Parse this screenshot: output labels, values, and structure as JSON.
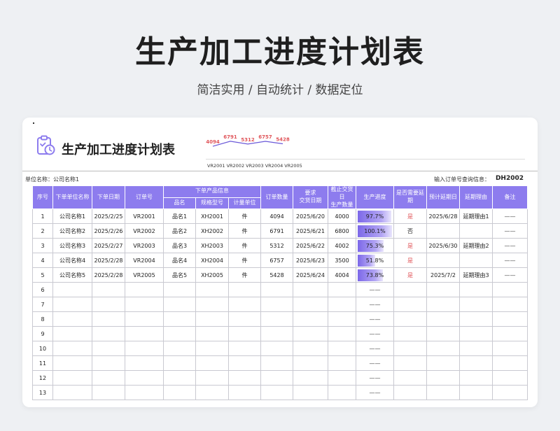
{
  "page": {
    "title": "生产加工进度计划表",
    "subtitle": "简洁实用 / 自动统计 / 数据定位"
  },
  "sheet": {
    "title": "生产加工进度计划表",
    "icon": "clipboard-clock-icon",
    "accent_color": "#8d7cee",
    "warning_color": "#e0555a"
  },
  "sparkline": {
    "categories": [
      "VR2001",
      "VR2002",
      "VR2003",
      "VR2004",
      "VR2005"
    ],
    "values": [
      4094,
      6791,
      5312,
      6757,
      5428
    ],
    "labels": [
      "4094",
      "6791",
      "5312",
      "6757",
      "5428"
    ],
    "categories_text": "VR2001 VR2002 VR2003 VR2004 VR2005"
  },
  "info": {
    "unit_label": "单位名称：公司名称1",
    "query_label": "输入订单号查询信息：",
    "query_value": "DH2002"
  },
  "table": {
    "headers": {
      "seq": "序号",
      "unit": "下单单位名称",
      "date": "下单日期",
      "order": "订单号",
      "product_group": "下单产品信息",
      "name": "品名",
      "spec": "规格型号",
      "measure": "计量单位",
      "qty": "订单数量",
      "required_line1": "要求",
      "required_line2": "交货日期",
      "delivered_line1": "截止交货日",
      "delivered_line2": "生产数量",
      "progress": "生产进度",
      "delay_line1": "是否需要延",
      "delay_line2": "期",
      "plan": "预计延期日",
      "reason": "延期理由",
      "note": "备注"
    },
    "rows": [
      {
        "seq": "1",
        "unit": "公司名称1",
        "date": "2025/2/25",
        "order": "VR2001",
        "name": "品名1",
        "spec": "XH2001",
        "measure": "件",
        "qty": "4094",
        "required": "2025/6/20",
        "produced": "4000",
        "progress": 0.977,
        "progress_text": "97.7%",
        "delay": "是",
        "plan": "2025/6/28",
        "reason": "延期理由1",
        "note": "——"
      },
      {
        "seq": "2",
        "unit": "公司名称2",
        "date": "2025/2/26",
        "order": "VR2002",
        "name": "品名2",
        "spec": "XH2002",
        "measure": "件",
        "qty": "6791",
        "required": "2025/6/21",
        "produced": "6800",
        "progress": 1.0,
        "progress_text": "100.1%",
        "delay": "否",
        "plan": "",
        "reason": "",
        "note": "——"
      },
      {
        "seq": "3",
        "unit": "公司名称3",
        "date": "2025/2/27",
        "order": "VR2003",
        "name": "品名3",
        "spec": "XH2003",
        "measure": "件",
        "qty": "5312",
        "required": "2025/6/22",
        "produced": "4002",
        "progress": 0.753,
        "progress_text": "75.3%",
        "delay": "是",
        "plan": "2025/6/30",
        "reason": "延期理由2",
        "note": "——"
      },
      {
        "seq": "4",
        "unit": "公司名称4",
        "date": "2025/2/28",
        "order": "VR2004",
        "name": "品名4",
        "spec": "XH2004",
        "measure": "件",
        "qty": "6757",
        "required": "2025/6/23",
        "produced": "3500",
        "progress": 0.518,
        "progress_text": "51.8%",
        "delay": "是",
        "plan": "",
        "reason": "",
        "note": "——"
      },
      {
        "seq": "5",
        "unit": "公司名称5",
        "date": "2025/2/28",
        "order": "VR2005",
        "name": "品名5",
        "spec": "XH2005",
        "measure": "件",
        "qty": "5428",
        "required": "2025/6/24",
        "produced": "4004",
        "progress": 0.738,
        "progress_text": "73.8%",
        "delay": "是",
        "plan": "2025/7/2",
        "reason": "延期理由3",
        "note": "——"
      }
    ],
    "empty_rows": [
      "6",
      "7",
      "8",
      "9",
      "10",
      "11",
      "12",
      "13"
    ],
    "empty_dash": "——"
  }
}
